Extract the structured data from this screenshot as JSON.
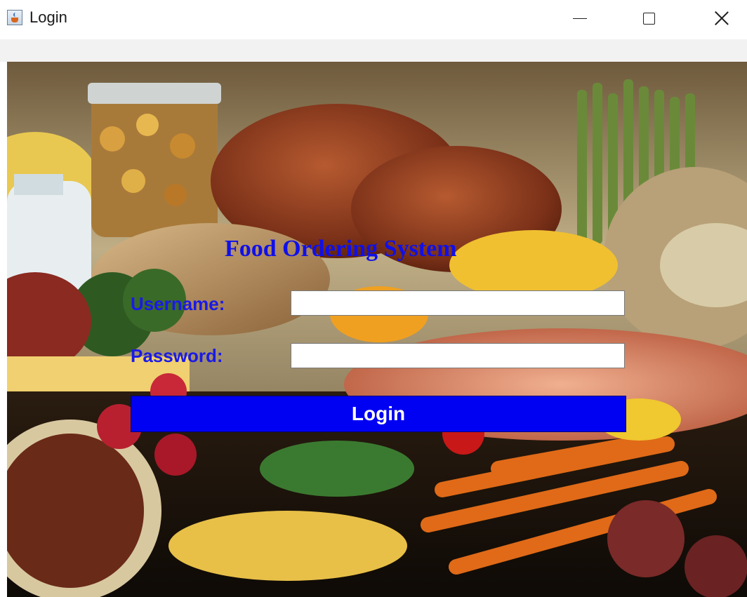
{
  "window": {
    "title": "Login",
    "icon": "java-cup-icon",
    "controls": {
      "minimize_icon": "minimize-icon",
      "maximize_icon": "maximize-icon",
      "close_icon": "close-icon"
    }
  },
  "form": {
    "heading": "Food Ordering System",
    "username_label": "Username:",
    "username_value": "",
    "password_label": "Password:",
    "password_value": "",
    "login_label": "Login"
  },
  "colors": {
    "label_blue": "#1a1ae6",
    "heading_blue": "#1010e8",
    "button_blue": "#0000f2",
    "button_text": "#ffffff"
  }
}
